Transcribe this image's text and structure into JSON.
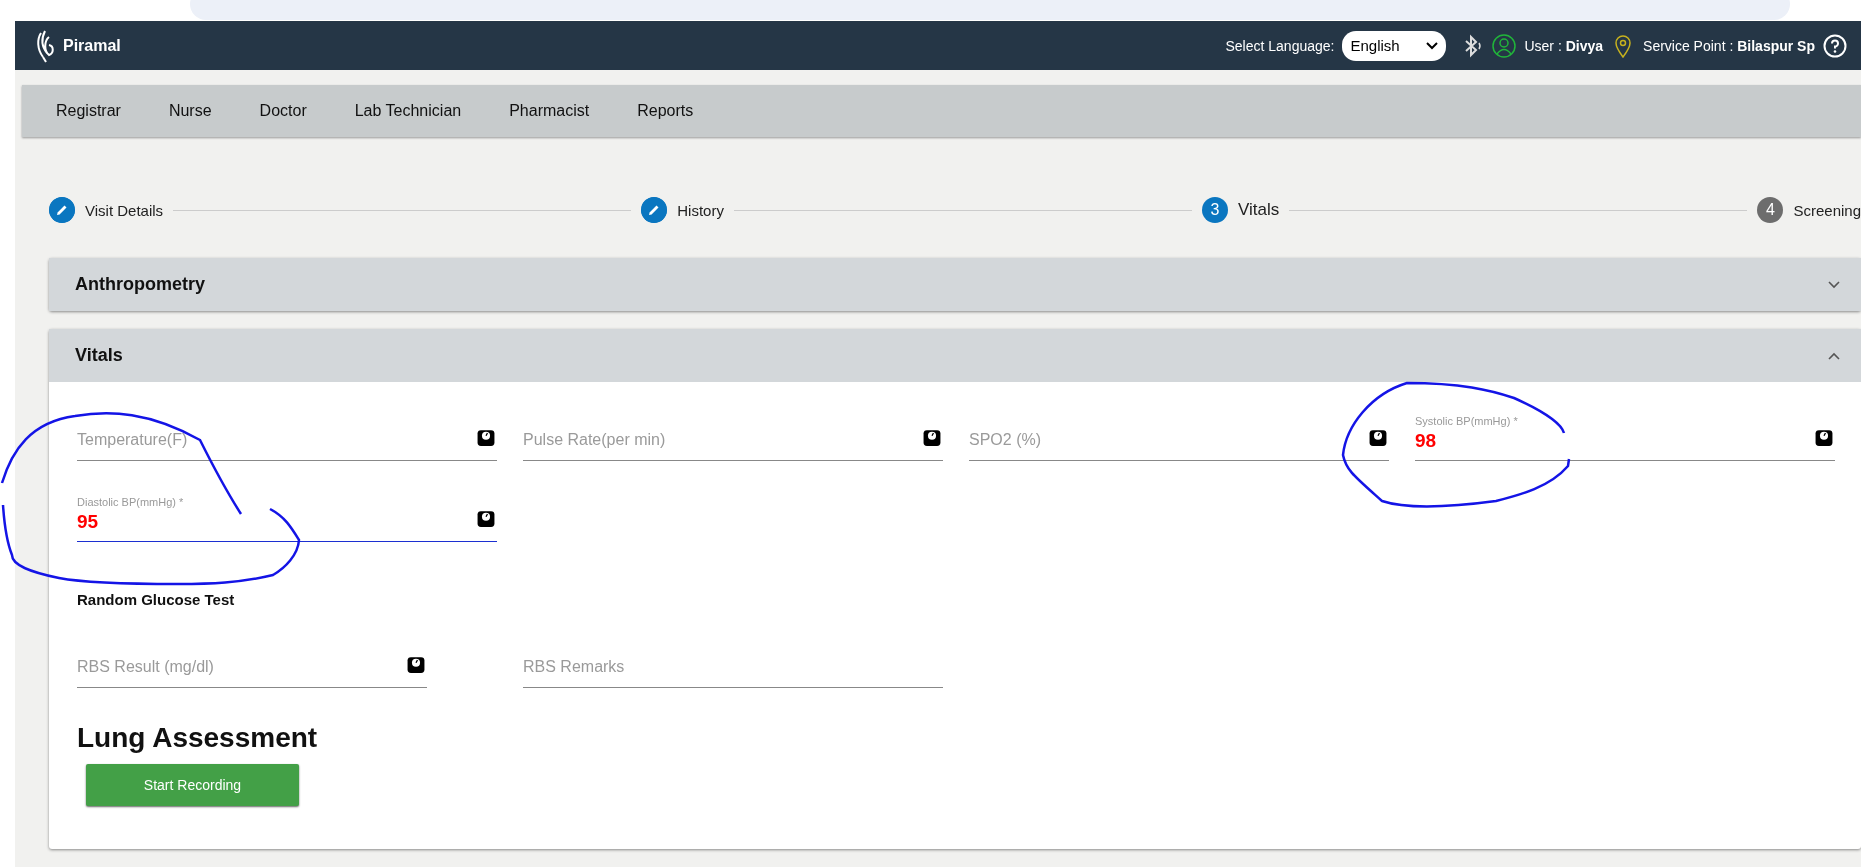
{
  "header": {
    "brand": "Piramal",
    "language_label": "Select Language:",
    "language": "English",
    "user_label": "User :",
    "user": "Divya",
    "service_label": "Service Point :",
    "service_point": "Bilaspur Sp"
  },
  "nav": [
    "Registrar",
    "Nurse",
    "Doctor",
    "Lab Technician",
    "Pharmacist",
    "Reports"
  ],
  "steps": [
    {
      "label": "Visit Details",
      "kind": "done"
    },
    {
      "label": "History",
      "kind": "done"
    },
    {
      "number": "3",
      "label": "Vitals",
      "kind": "active"
    },
    {
      "number": "4",
      "label": "Screening",
      "kind": "pending"
    }
  ],
  "panels": [
    {
      "title": "Anthropometry",
      "expanded": false
    },
    {
      "title": "Vitals",
      "expanded": true
    }
  ],
  "vitals_rows": [
    [
      {
        "placeholder": "Temperature(F)",
        "focused": false
      },
      {
        "placeholder": "Pulse Rate(per min)",
        "focused": false
      },
      {
        "placeholder": "SPO2 (%)",
        "focused": false
      },
      {
        "label": "Systolic BP(mmHg) *",
        "value": "98",
        "focused": false
      }
    ],
    [
      {
        "label": "Diastolic BP(mmHg) *",
        "value": "95",
        "focused": true
      }
    ]
  ],
  "glucose": {
    "title": "Random Glucose Test",
    "fields": [
      {
        "placeholder": "RBS Result (mg/dl)",
        "icon": true,
        "focused": false
      },
      {
        "placeholder": "RBS Remarks",
        "icon": false,
        "focused": false
      }
    ]
  },
  "lung": {
    "title": "Lung Assessment",
    "button": "Start Recording"
  }
}
